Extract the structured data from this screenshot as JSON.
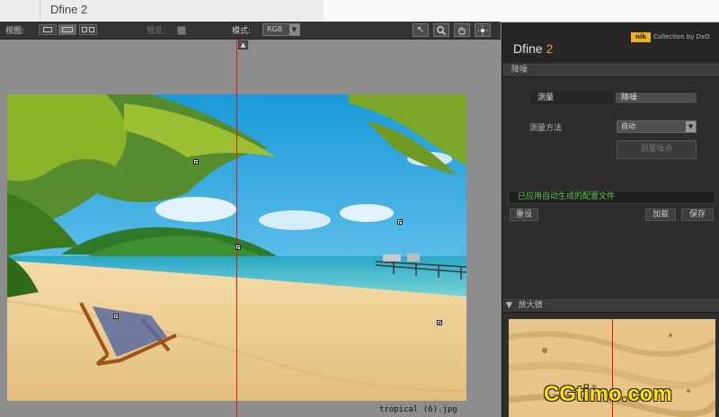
{
  "app": {
    "title": "Dfine 2"
  },
  "toolbar": {
    "view_label": "视图:",
    "preview_label": "预览:",
    "mode_label": "模式:",
    "mode_value": "RGB",
    "tools": [
      "pointer-tool-icon",
      "zoom-tool-icon",
      "hand-tool-icon",
      "brightness-tool-icon"
    ]
  },
  "canvas": {
    "filename": "tropical (6).jpg",
    "split_view": true
  },
  "panel": {
    "brand": {
      "logo": "nik",
      "collection": "Collection by DxO",
      "name": "Dfine",
      "version": "2"
    },
    "noise_section": "降噪",
    "tabs": [
      "测量",
      "降噪"
    ],
    "method_label": "测量方法",
    "method_value": "自动",
    "measure_button": "测量噪点",
    "status": "已应用自动生成的配置文件",
    "reset_button": "重设",
    "load_button": "加载",
    "save_button": "保存",
    "loupe_section": "放大镜"
  },
  "watermark": "CGtimo.com",
  "colors": {
    "accent": "#f0a01e",
    "status_green": "#5cc850",
    "split_line": "#d21a1a",
    "panel_bg": "#2d2d2d"
  }
}
